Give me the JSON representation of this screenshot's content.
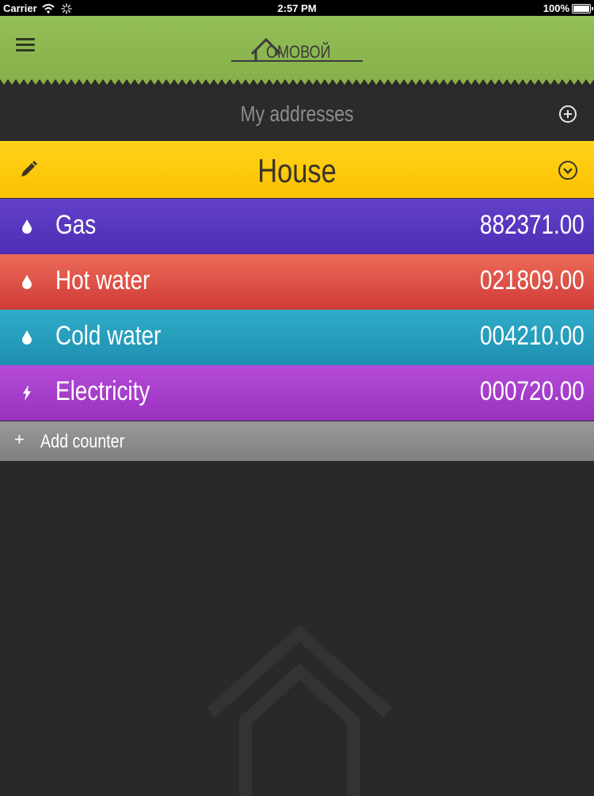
{
  "status_bar": {
    "carrier": "Carrier",
    "time": "2:57 PM",
    "battery": "100%"
  },
  "header": {
    "logo_text": "ОМОВОЙ",
    "menu_icon": "hamburger-menu-icon"
  },
  "addresses": {
    "title": "My addresses",
    "add_icon": "plus-circle-icon"
  },
  "address": {
    "name": "House",
    "edit_icon": "pencil-icon",
    "expand_icon": "chevron-down-circle-icon"
  },
  "counters": [
    {
      "label": "Gas",
      "value": "882371.00",
      "icon": "drop-icon",
      "color": "#5a37c0"
    },
    {
      "label": "Hot water",
      "value": "021809.00",
      "icon": "drop-icon",
      "color": "#e0524a"
    },
    {
      "label": "Cold water",
      "value": "004210.00",
      "icon": "drop-icon",
      "color": "#26a0bf"
    },
    {
      "label": "Electricity",
      "value": "000720.00",
      "icon": "lightning-icon",
      "color": "#aa40cd"
    }
  ],
  "add_counter": {
    "plus": "+",
    "label": "Add counter"
  },
  "colors": {
    "header_green": "#8db952",
    "address_yellow": "#fdc90c",
    "background": "#292929"
  }
}
